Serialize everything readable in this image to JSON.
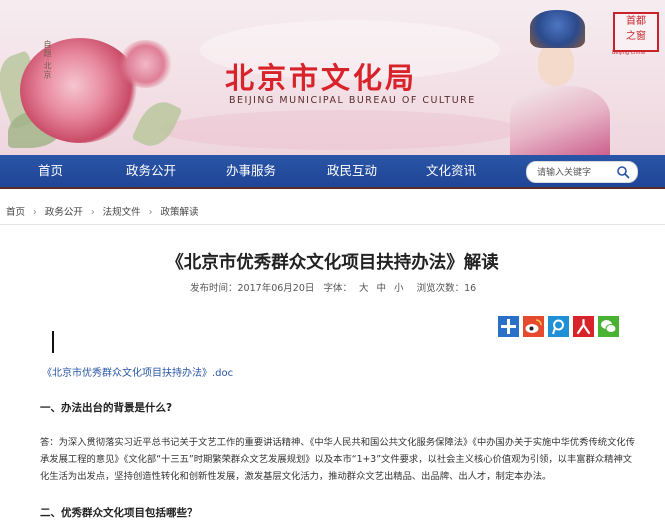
{
  "header": {
    "title_cn": "北京市文化局",
    "title_en": "BEIJING MUNICIPAL BUREAU OF CULTURE",
    "calligraphy": "自题·北京",
    "seal_text": [
      "首",
      "都",
      "之",
      "窗"
    ],
    "seal_sub": "Beijing China"
  },
  "nav": {
    "items": [
      "首页",
      "政务公开",
      "办事服务",
      "政民互动",
      "文化资讯"
    ],
    "search_placeholder": "请输入关键字"
  },
  "breadcrumb": [
    "首页",
    "政务公开",
    "法规文件",
    "政策解读"
  ],
  "article": {
    "title": "《北京市优秀群众文化项目扶持办法》解读",
    "publish_label": "发布时间：",
    "publish_date": "2017年06月20日",
    "font_label": "字体：",
    "font_sizes": [
      "大",
      "中",
      "小"
    ],
    "views_label": "浏览次数：",
    "views": "16",
    "attachment": "《北京市优秀群众文化项目扶持办法》.doc",
    "heading1": "一、办法出台的背景是什么?",
    "paragraph1": "答：为深入贯彻落实习近平总书记关于文艺工作的重要讲话精神、《中华人民共和国公共文化服务保障法》《中办国办关于实施中华优秀传统文化传承发展工程的意见》《文化部“十三五”时期繁荣群众文艺发展规划》以及本市“1+3”文件要求，以社会主义核心价值观为引领，以丰富群众精神文化生活为出发点，坚持创造性转化和创新性发展，激发基层文化活力，推动群众文艺出精品、出品牌、出人才，制定本办法。",
    "heading2": "二、优秀群众文化项目包括哪些？"
  },
  "share_icons": [
    "share-plus-icon",
    "weibo-icon",
    "tencent-weibo-icon",
    "renren-icon",
    "wechat-icon"
  ],
  "colors": {
    "nav_bg": "#1f4597",
    "title_red": "#d8232a",
    "link_blue": "#2a56a4"
  }
}
